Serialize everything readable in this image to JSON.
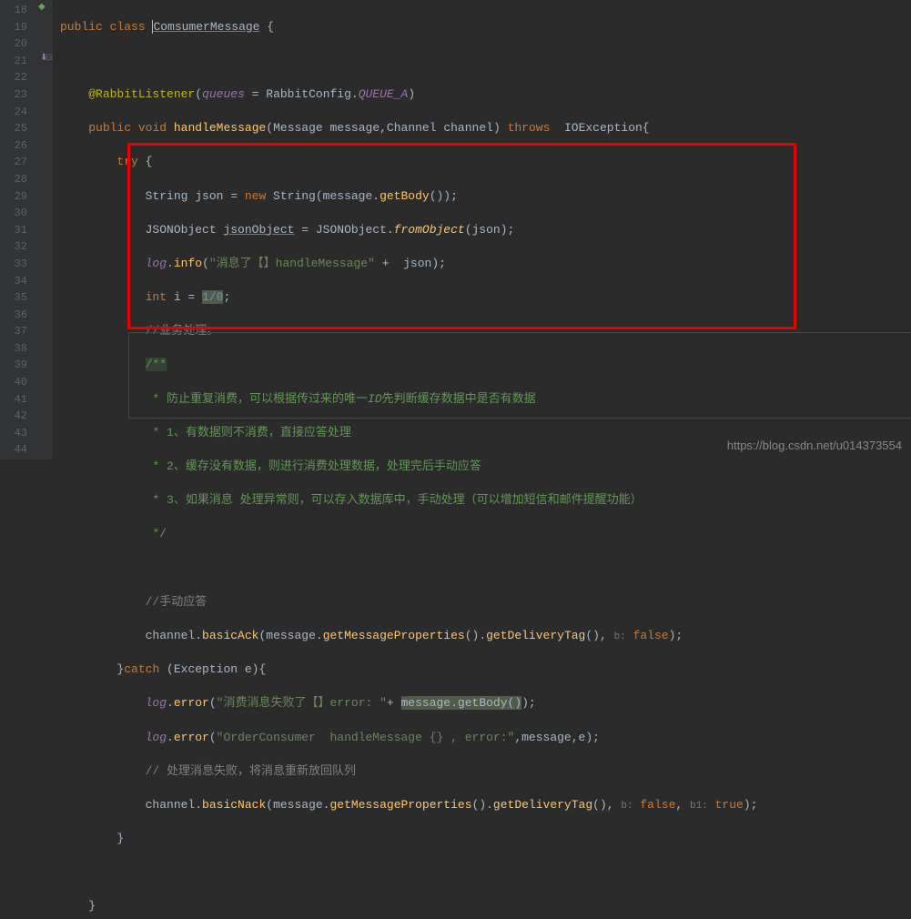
{
  "gutter": {
    "start": 18,
    "end": 44
  },
  "code": {
    "l18": {
      "kw1": "public",
      "kw2": "class",
      "name": "ComsumerMessage",
      "brace": "{"
    },
    "l20": {
      "annot": "@RabbitListener",
      "paren_open": "(",
      "param": "queues",
      "eq": " = ",
      "cls": "RabbitConfig.",
      "field": "QUEUE_A",
      "paren_close": ")"
    },
    "l21": {
      "kw1": "public",
      "kw2": "void",
      "method": "handleMessage",
      "params": "(Message message,Channel channel)",
      "kw3": "throws",
      "exc": "  IOException{"
    },
    "l22": {
      "kw": "try",
      "brace": " {"
    },
    "l23": {
      "type": "String ",
      "var": "json = ",
      "kw": "new",
      "cls": " String(message.",
      "m": "getBody",
      "rest": "());"
    },
    "l24": {
      "type": "JSONObject ",
      "var": "jsonObject",
      "eq": " = JSONObject.",
      "m": "fromObject",
      "rest": "(json);"
    },
    "l25": {
      "log": "log",
      "dot": ".",
      "m": "info",
      "paren": "(",
      "str": "\"消息了【】handleMessage\"",
      "plus": " +  json);"
    },
    "l26": {
      "kw": "int",
      "var": " i = ",
      "expr": "1/0",
      "semi": ";"
    },
    "l27": {
      "c": "//业务处理。"
    },
    "l28": {
      "c": "/**"
    },
    "l29": {
      "c": " * 防止重复消费，可以根据传过来的唯一",
      "id": "ID",
      "c2": "先判断缓存数据中是否有数据"
    },
    "l30": {
      "c": " * 1、有数据则不消费，直接应答处理"
    },
    "l31": {
      "c": " * 2、缓存没有数据，则进行消费处理数据，处理完后手动应答"
    },
    "l32": {
      "c": " * 3、如果消息 处理异常则，可以存入数据库中，手动处理（可以增加短信和邮件提醒功能）"
    },
    "l33": {
      "c": " */"
    },
    "l35": {
      "c": "//手动应答"
    },
    "l36": {
      "obj": "channel.",
      "m": "basicAck",
      "p1": "(message.",
      "m2": "getMessageProperties",
      "p2": "().",
      "m3": "getDeliveryTag",
      "p3": "(), ",
      "hint": "b:",
      "sp": " ",
      "kw": "false",
      "end": ");"
    },
    "l37": {
      "brace": "}",
      "kw": "catch",
      "params": " (Exception e){"
    },
    "l38": {
      "log": "log",
      "dot": ".",
      "m": "error",
      "paren": "(",
      "str": "\"消费消息失败了【】error: \"",
      "plus": "+ ",
      "hl": "message.getBody()",
      "end": ");"
    },
    "l39": {
      "log": "log",
      "dot": ".",
      "m": "error",
      "paren": "(",
      "str": "\"OrderConsumer  handleMessage {} , error:\"",
      "rest": ",message,e);"
    },
    "l40": {
      "c": "// 处理消息失败，将消息重新放回队列"
    },
    "l41": {
      "obj": "channel.",
      "m": "basicNack",
      "p1": "(message.",
      "m2": "getMessageProperties",
      "p2": "().",
      "m3": "getDeliveryTag",
      "p3": "(), ",
      "hint1": "b:",
      "sp1": " ",
      "kw1": "false",
      "c1": ", ",
      "hint2": "b1:",
      "sp2": " ",
      "kw2": "true",
      "end": ");"
    },
    "l42": {
      "brace": "}"
    },
    "l44": {
      "brace": "}"
    }
  },
  "icons": {
    "override": "⬇",
    "collapse": "⊟"
  },
  "watermark": "https://blog.csdn.net/u014373554"
}
